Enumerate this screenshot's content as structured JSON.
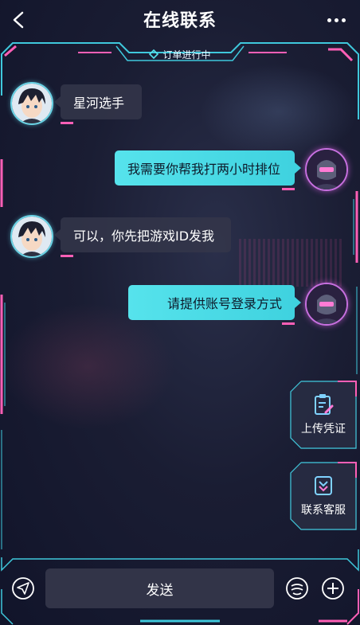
{
  "header": {
    "title": "在线联系"
  },
  "status": {
    "label": "订单进行中"
  },
  "messages": [
    {
      "side": "left",
      "text": "星河选手"
    },
    {
      "side": "right",
      "text": "我需要你帮我打两小时排位"
    },
    {
      "side": "left",
      "text": "可以，你先把游戏ID发我"
    },
    {
      "side": "right",
      "text": "请提供账号登录方式"
    }
  ],
  "side_actions": [
    {
      "label": "上传凭证",
      "icon": "upload-document-icon"
    },
    {
      "label": "联系客服",
      "icon": "customer-service-icon"
    }
  ],
  "input": {
    "send_label": "发送"
  },
  "colors": {
    "cyan": "#56e3ec",
    "pink": "#ff5fb6",
    "bubble_dark": "#34364a",
    "background": "#1a1d33"
  }
}
